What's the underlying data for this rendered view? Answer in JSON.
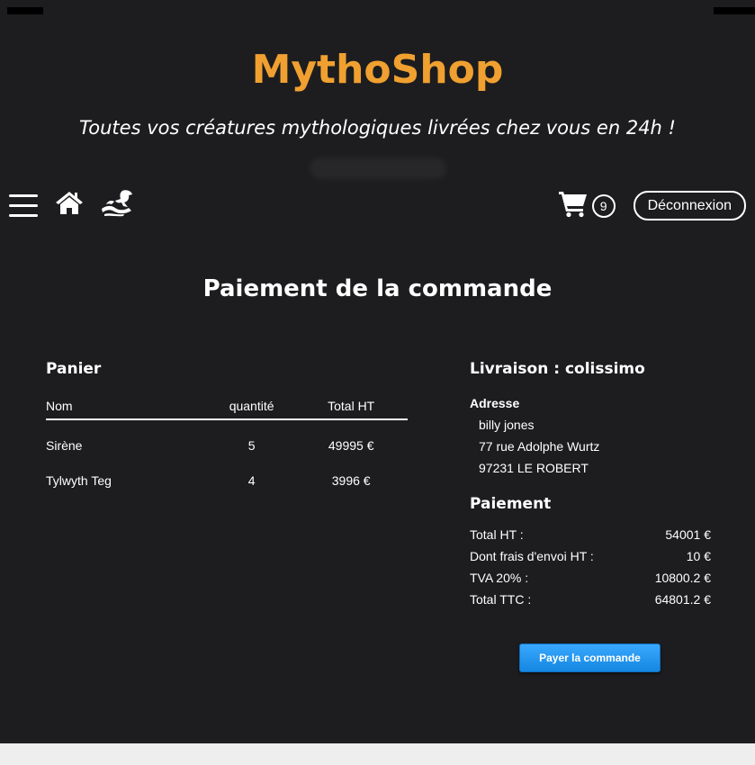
{
  "header": {
    "brand": "MythoShop",
    "tagline": "Toutes vos créatures mythologiques livrées chez vous en 24h !"
  },
  "nav": {
    "icons": [
      "menu-icon",
      "home-icon",
      "creature-icon",
      "cart-icon"
    ],
    "cart_count": "9",
    "logout_label": "Déconnexion"
  },
  "page_title": "Paiement de la commande",
  "cart": {
    "title": "Panier",
    "columns": {
      "name": "Nom",
      "quantity": "quantité",
      "total": "Total HT"
    },
    "rows": [
      {
        "name": "Sirène",
        "quantity": "5",
        "total": "49995 €"
      },
      {
        "name": "Tylwyth Teg",
        "quantity": "4",
        "total": "3996 €"
      }
    ]
  },
  "delivery": {
    "title": "Livraison : colissimo",
    "address_label": "Adresse",
    "address_lines": [
      "billy jones",
      "77 rue Adolphe Wurtz",
      "97231 LE ROBERT"
    ]
  },
  "payment": {
    "title": "Paiement",
    "rows": [
      {
        "label": "Total HT :",
        "value": "54001 €"
      },
      {
        "label": "Dont frais d'envoi HT :",
        "value": "10 €"
      },
      {
        "label": "TVA 20% :",
        "value": "10800.2 €"
      },
      {
        "label": "Total TTC :",
        "value": "64801.2 €"
      }
    ],
    "button_label": "Payer la commande"
  },
  "colors": {
    "background": "#1d1d1f",
    "brand": "#f0a030",
    "button": "#1e96f0"
  }
}
